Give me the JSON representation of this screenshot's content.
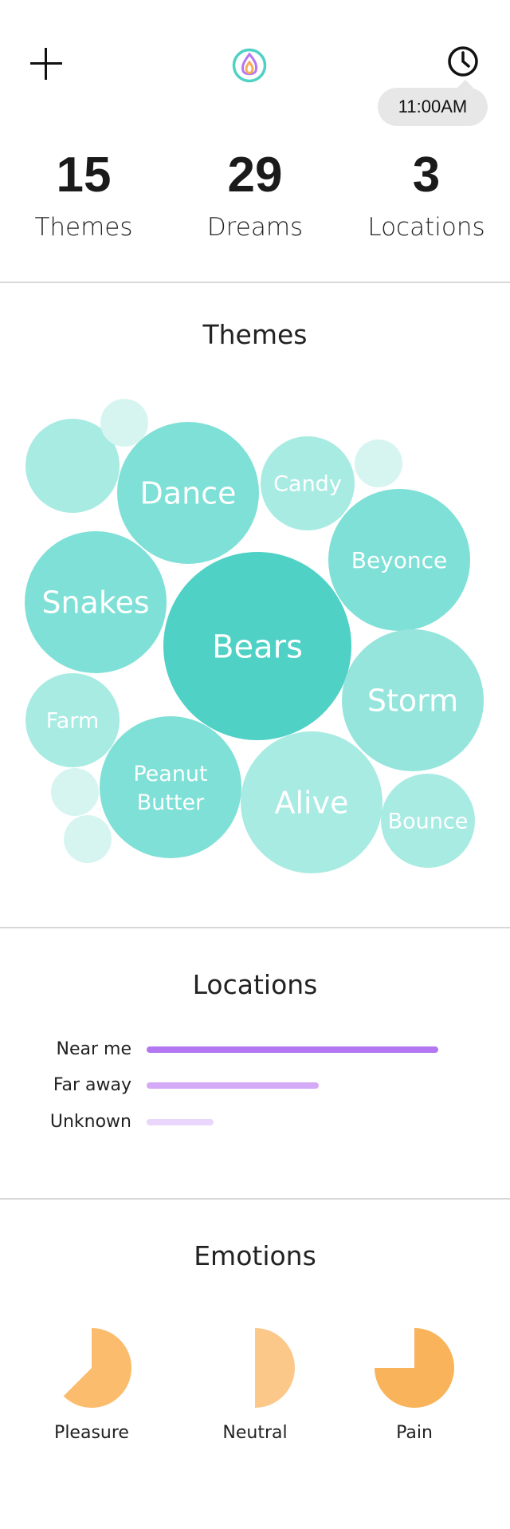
{
  "header": {
    "add_icon": "plus-icon",
    "logo_icon": "flame-logo-icon",
    "clock_icon": "clock-icon",
    "tooltip_time": "11:00AM",
    "colors": {
      "logo_ring": "#4fd1c5",
      "flame_outer": "#b377f1",
      "flame_inner": "#f6ad55"
    }
  },
  "stats": [
    {
      "value": "15",
      "label": "Themes"
    },
    {
      "value": "29",
      "label": "Dreams"
    },
    {
      "value": "3",
      "label": "Locations"
    }
  ],
  "themes": {
    "title": "Themes",
    "bubbles": [
      {
        "label": "Bears",
        "color": "#4fd1c5"
      },
      {
        "label": "Dance",
        "color": "#7ee0d6"
      },
      {
        "label": "Snakes",
        "color": "#7ee0d6"
      },
      {
        "label": "Beyonce",
        "color": "#7ee0d6"
      },
      {
        "label": "Storm",
        "color": "#95e5dc"
      },
      {
        "label": "Peanut Butter",
        "color": "#7ee0d6"
      },
      {
        "label": "Alive",
        "color": "#a8ebe3"
      },
      {
        "label": "Candy",
        "color": "#a8ebe3"
      },
      {
        "label": "Farm",
        "color": "#a8ebe3"
      },
      {
        "label": "Bounce",
        "color": "#a8ebe3"
      },
      {
        "label": "",
        "color": "#a8ebe3"
      },
      {
        "label": "",
        "color": "#d6f5f1"
      },
      {
        "label": "",
        "color": "#d6f5f1"
      },
      {
        "label": "",
        "color": "#d6f5f1"
      },
      {
        "label": "",
        "color": "#d6f5f1"
      }
    ]
  },
  "locations": {
    "title": "Locations",
    "items": [
      {
        "label": "Near me",
        "value": 1.0,
        "color": "#b377f1"
      },
      {
        "label": "Far away",
        "value": 0.59,
        "color": "#d4aaf7"
      },
      {
        "label": "Unknown",
        "value": 0.23,
        "color": "#ead5fb"
      }
    ]
  },
  "emotions": {
    "title": "Emotions",
    "items": [
      {
        "label": "Pleasure",
        "fraction": 0.625,
        "color": "#fbbd6d"
      },
      {
        "label": "Neutral",
        "fraction": 0.5,
        "color": "#fcc88a"
      },
      {
        "label": "Pain",
        "fraction": 0.75,
        "color": "#f9b35a"
      }
    ]
  }
}
